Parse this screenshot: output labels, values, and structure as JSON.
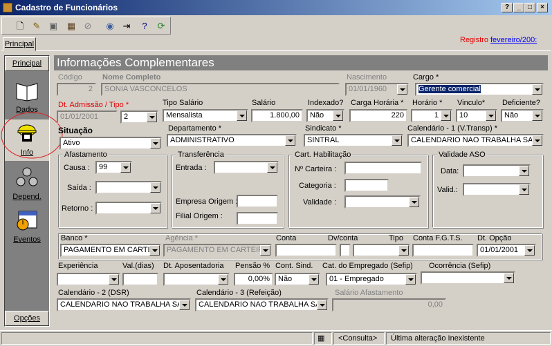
{
  "window": {
    "title": "Cadastro de Funcionários"
  },
  "toolbar": {
    "icons": [
      "new-icon",
      "edit-icon",
      "save-icon",
      "delete-icon",
      "cancel-icon",
      "search-icon",
      "exit-icon",
      "help-icon",
      "refresh-icon"
    ]
  },
  "registro": {
    "label": "Registro :",
    "value": "fevereiro/200:"
  },
  "tabs": {
    "principal": "Principal"
  },
  "sidebar": {
    "principal": "Principal",
    "opcoes": "Opções",
    "dados": "Dados",
    "info": "Info",
    "dependentes": "Depend.",
    "eventos": "Eventos"
  },
  "panel": {
    "title": "Informações Complementares"
  },
  "form": {
    "codigo": {
      "label": "Código",
      "value": "2"
    },
    "nome": {
      "label": "Nome Completo",
      "value": "SONIA VASCONCELOS"
    },
    "nascimento": {
      "label": "Nascimento",
      "value": "01/01/1960"
    },
    "cargo": {
      "label": "Cargo *",
      "value": "Gerente comercial"
    },
    "admissao": {
      "label": "Dt. Admissão / Tipo *",
      "value": "01/01/2001",
      "tipo": "2"
    },
    "tipo_salario": {
      "label": "Tipo Salário",
      "value": "Mensalista"
    },
    "salario": {
      "label": "Salário",
      "value": "1.800,00"
    },
    "indexado": {
      "label": "Indexado?",
      "value": "Não"
    },
    "carga": {
      "label": "Carga Horária *",
      "value": "220"
    },
    "horario": {
      "label": "Horário *",
      "value": "1"
    },
    "vinculo": {
      "label": "Vinculo*",
      "value": "10"
    },
    "deficiente": {
      "label": "Deficiente?",
      "value": "Não"
    },
    "situacao": {
      "label": "Situação",
      "value": "Ativo"
    },
    "departamento": {
      "label": "Departamento *",
      "value": "ADMINISTRATIVO"
    },
    "sindicato": {
      "label": "Sindicato *",
      "value": "SINTRAL"
    },
    "calendario1": {
      "label": "Calendário - 1 (V.Transp) *",
      "value": "CALENDARIO NAO TRABALHA SABAD"
    },
    "afastamento": {
      "title": "Afastamento",
      "causa_label": "Causa :",
      "causa": "99",
      "saida_label": "Saída :",
      "retorno_label": "Retorno :"
    },
    "transferencia": {
      "title": "Transferência",
      "entrada_label": "Entrada :",
      "empresa_label": "Empresa Origem :",
      "filial_label": "Filial Origem :"
    },
    "habilitacao": {
      "title": "Cart. Habilitação",
      "carteira_label": "Nº Carteira :",
      "categoria_label": "Categoria :",
      "validade_label": "Validade :"
    },
    "aso": {
      "title": "Validade ASO",
      "data_label": "Data:",
      "valid_label": "Valid.:"
    },
    "banco": {
      "label": "Banco *",
      "value": "PAGAMENTO EM CARTEIR"
    },
    "agencia": {
      "label": "Agência *",
      "value": "PAGAMENTO EM CARTEIRA"
    },
    "conta": {
      "label": "Conta"
    },
    "dvconta": {
      "label": "Dv/conta"
    },
    "tipo_conta": {
      "label": "Tipo"
    },
    "conta_fgts": {
      "label": "Conta F.G.T.S."
    },
    "dt_opcao": {
      "label": "Dt. Opção",
      "value": "01/01/2001"
    },
    "experiencia": {
      "label": "Experiência"
    },
    "val_dias": {
      "label": "Val.(dias)"
    },
    "dt_aposentadoria": {
      "label": "Dt. Aposentadoria"
    },
    "pensao": {
      "label": "Pensão %",
      "value": "0,00%"
    },
    "cont_sind": {
      "label": "Cont. Sind.",
      "value": "Não"
    },
    "cat_empregado": {
      "label": "Cat. do Empregado (Sefip)",
      "value": "01 - Empregado"
    },
    "ocorrencia": {
      "label": "Ocorrência (Sefip)"
    },
    "calendario2": {
      "label": "Calendário - 2 (DSR)",
      "value": "CALENDARIO NAO TRABALHA SABA"
    },
    "calendario3": {
      "label": "Calendário - 3 (Refeição)",
      "value": "CALENDARIO NAO TRABALHA SABA"
    },
    "salario_afast": {
      "label": "Salário Afastamento",
      "value": "0,00"
    }
  },
  "status": {
    "mode": "<Consulta>",
    "last_change": "Última alteração Inexistente"
  }
}
